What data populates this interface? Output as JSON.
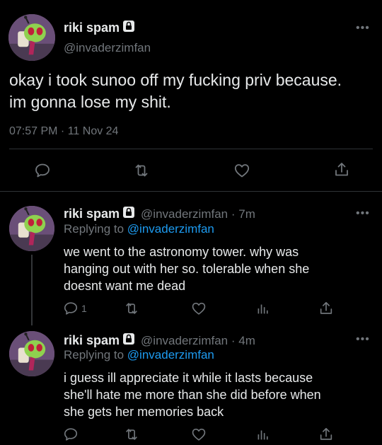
{
  "main_tweet": {
    "display_name": "riki spam",
    "handle": "@invaderzimfan",
    "text_line1": "okay i took sunoo off my fucking priv because.",
    "text_line2": "im gonna lose my shit.",
    "timestamp": "07:57 PM · 11 Nov 24",
    "more_label": "•••"
  },
  "replies": [
    {
      "display_name": "riki spam",
      "handle_time": "@invaderzimfan · 7m",
      "replying_prefix": "Replying to",
      "replying_handle": "@invaderzimfan",
      "line1": "we went to the astronomy tower. why was",
      "line2": "hanging out with her so. tolerable when she",
      "line3": "doesnt want me dead",
      "reply_count": "1",
      "more_label": "•••"
    },
    {
      "display_name": "riki spam",
      "handle_time": "@invaderzimfan · 4m",
      "replying_prefix": "Replying to",
      "replying_handle": "@invaderzimfan",
      "line1": "i guess ill appreciate it while it lasts because",
      "line2": "she'll hate me more than she did before when",
      "line3": "she gets her memories back",
      "more_label": "•••"
    }
  ],
  "icons": [
    "reply-icon",
    "retweet-icon",
    "like-icon",
    "share-icon",
    "analytics-icon",
    "lock-icon",
    "more-icon"
  ],
  "colors": {
    "background": "#000000",
    "text": "#e7e9ea",
    "secondary": "#71767b",
    "link": "#1d9bf0",
    "divider": "#2f3336"
  }
}
